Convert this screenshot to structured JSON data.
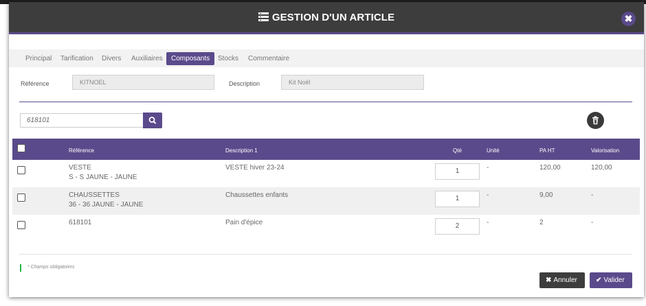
{
  "modal": {
    "title": "GESTION D'UN ARTICLE",
    "close_symbol": "✖",
    "title_icon": "list-icon"
  },
  "tabs": [
    {
      "label": "Principal",
      "active": false
    },
    {
      "label": "Tarification",
      "active": false
    },
    {
      "label": "Divers",
      "active": false
    },
    {
      "label": "Auxiliaires",
      "active": false
    },
    {
      "label": "Composants",
      "active": true
    },
    {
      "label": "Stocks",
      "active": false
    },
    {
      "label": "Commentaire",
      "active": false
    }
  ],
  "fields": {
    "reference_label": "Référence",
    "reference_value": "KITNOEL",
    "description_label": "Description",
    "description_value": "Kit Noël"
  },
  "search": {
    "value": "618101",
    "button_icon": "search-icon"
  },
  "table": {
    "columns": [
      "Référence",
      "Description 1",
      "Qté",
      "Unité",
      "PA HT",
      "Valorisation"
    ],
    "rows": [
      {
        "ref_line1": "VESTE",
        "ref_line2": "S - S JAUNE - JAUNE",
        "description": "VESTE hiver 23-24",
        "qty": "1",
        "unit": "-",
        "pa_ht": "120,00",
        "valorisation": "120,00"
      },
      {
        "ref_line1": "CHAUSSETTES",
        "ref_line2": "36 - 36 JAUNE - JAUNE",
        "description": "Chaussettes enfants",
        "qty": "1",
        "unit": "-",
        "pa_ht": "9,00",
        "valorisation": "-"
      },
      {
        "ref_line1": "618101",
        "ref_line2": "",
        "description": "Pain d'épice",
        "qty": "2",
        "unit": "-",
        "pa_ht": "2",
        "valorisation": "-"
      }
    ]
  },
  "footer": {
    "required_note": "* Champs obligatoires",
    "cancel_label": "Annuler",
    "cancel_symbol": "✖",
    "ok_label": "Valider",
    "ok_symbol": "✔"
  },
  "colors": {
    "accent": "#5b4a8b",
    "header_bg": "#3d3d3d",
    "required_marker": "#29b34a"
  }
}
